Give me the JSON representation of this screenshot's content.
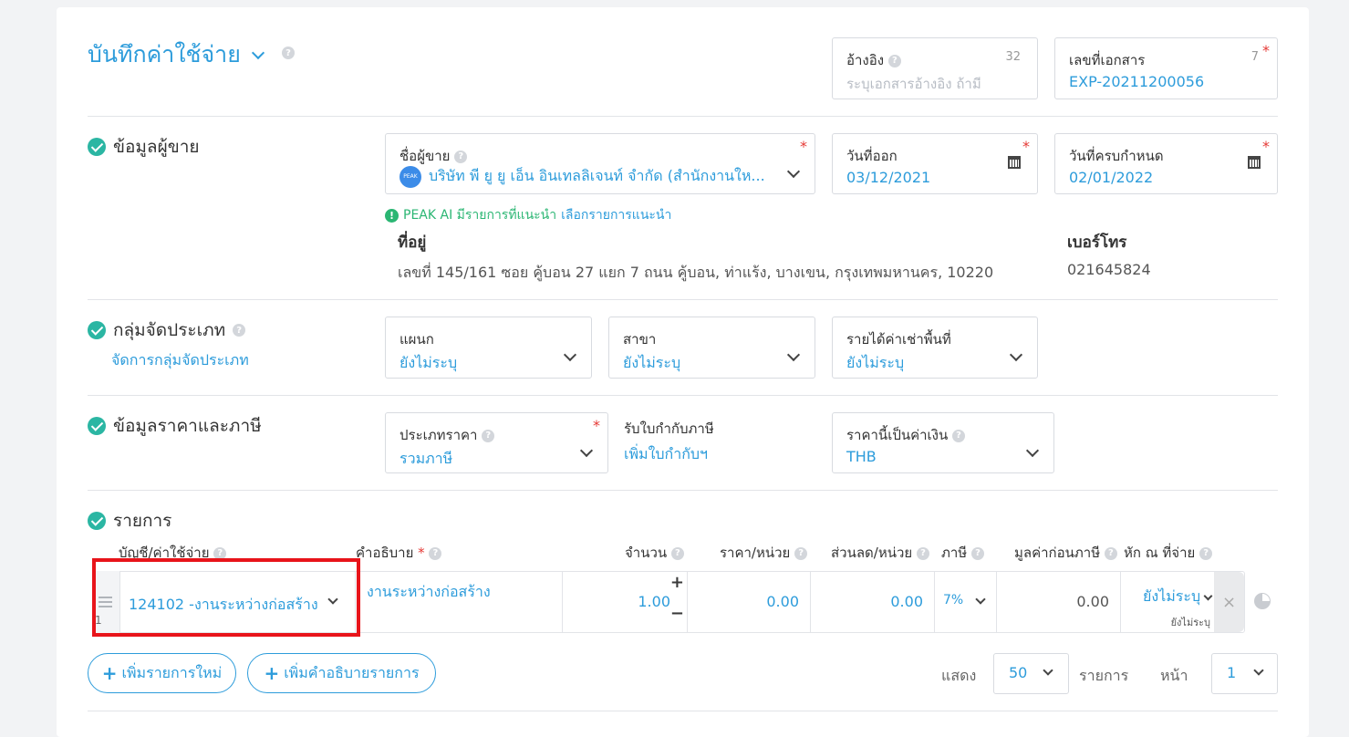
{
  "header": {
    "title": "บันทึกค่าใช้จ่าย",
    "reference": {
      "label": "อ้างอิง",
      "count": "32",
      "placeholder": "ระบุเอกสารอ้างอิง ถ้ามี"
    },
    "docno": {
      "label": "เลขที่เอกสาร",
      "count": "7",
      "value": "EXP-20211200056"
    }
  },
  "seller": {
    "section_title": "ข้อมูลผู้ขาย",
    "name_label": "ชื่อผู้ขาย",
    "logo_text": "PEAK",
    "name_value": "บริษัท พี ยู ยู เอ็น อินเทลลิเจนท์ จำกัด (สำนักงานให...",
    "issue_date_label": "วันที่ออก",
    "issue_date": "03/12/2021",
    "due_date_label": "วันที่ครบกำหนด",
    "due_date": "02/01/2022",
    "ai_hint_green": "PEAK AI มีรายการที่แนะนำ",
    "ai_hint_link": "เลือกรายการแนะนำ",
    "address_label": "ที่อยู่",
    "address": "เลขที่ 145/161 ซอย คู้บอน 27 แยก 7 ถนน คู้บอน, ท่าแร้ง, บางเขน, กรุงเทพมหานคร, 10220",
    "phone_label": "เบอร์โทร",
    "phone": "021645824"
  },
  "group": {
    "section_title": "กลุ่มจัดประเภท",
    "manage_link": "จัดการกลุ่มจัดประเภท",
    "dept_label": "แผนก",
    "dept_value": "ยังไม่ระบุ",
    "branch_label": "สาขา",
    "branch_value": "ยังไม่ระบุ",
    "rent_label": "รายได้ค่าเช่าพื้นที่",
    "rent_value": "ยังไม่ระบุ"
  },
  "price": {
    "section_title": "ข้อมูลราคาและภาษี",
    "type_label": "ประเภทราคา",
    "type_value": "รวมภาษี",
    "taxinv_label": "รับใบกำกับภาษี",
    "taxinv_link": "เพิ่มใบกำกับฯ",
    "currency_label": "ราคานี้เป็นค่าเงิน",
    "currency_value": "THB"
  },
  "items": {
    "section_title": "รายการ",
    "headers": {
      "account": "บัญชี/ค่าใช้จ่าย",
      "description": "คำอธิบาย",
      "qty": "จำนวน",
      "unit_price": "ราคา/หน่วย",
      "discount": "ส่วนลด/หน่วย",
      "tax": "ภาษี",
      "pretax": "มูลค่าก่อนภาษี",
      "withholding": "หัก ณ ที่จ่าย"
    },
    "row": {
      "index": "1",
      "account": "124102 -งานระหว่างก่อสร้าง",
      "description": "งานระหว่างก่อสร้าง",
      "qty": "1.00",
      "unit_price": "0.00",
      "discount": "0.00",
      "tax": "7%",
      "pretax": "0.00",
      "withholding": "ยังไม่ระบุ",
      "withholding_sub": "ยังไม่ระบุ"
    },
    "add_item": "เพิ่มรายการใหม่",
    "add_desc": "เพิ่มคำอธิบายรายการ",
    "show_label": "แสดง",
    "show_value": "50",
    "items_label": "รายการ",
    "page_label": "หน้า",
    "page_value": "1"
  },
  "colors": {
    "accent": "#2d9cdb",
    "check": "#2bb6a3",
    "required": "#e53935",
    "highlight": "#e8141a"
  }
}
